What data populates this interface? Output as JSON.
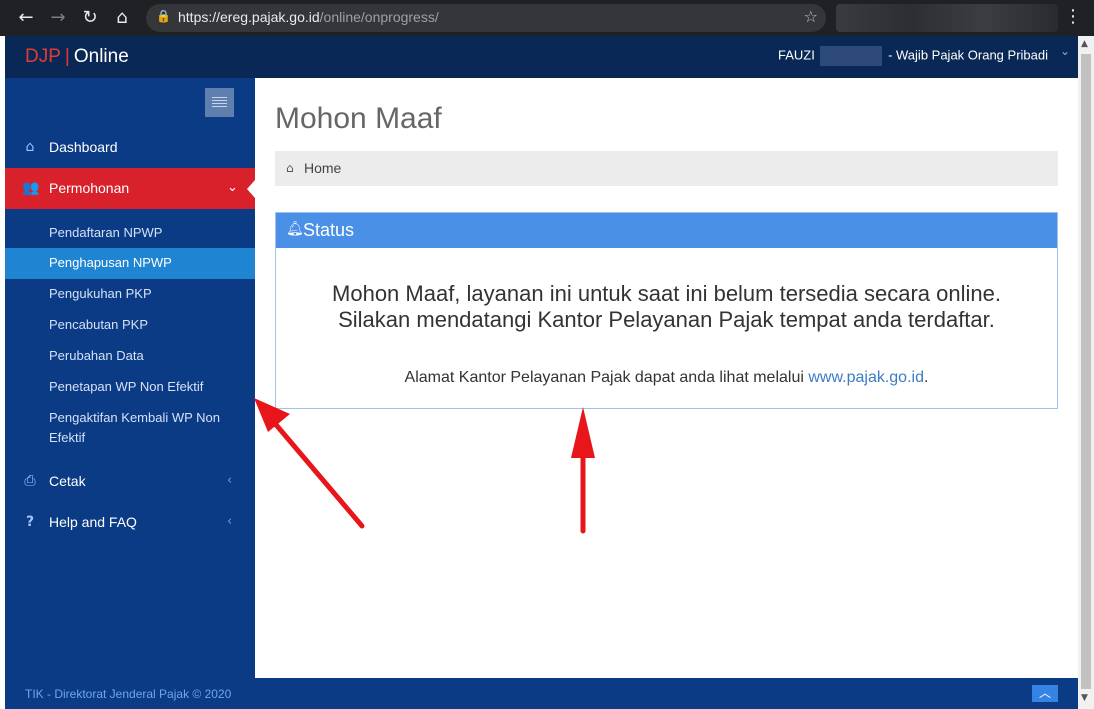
{
  "browser": {
    "url_host": "https://ereg.pajak.go.id",
    "url_path": "/online/onprogress/"
  },
  "header": {
    "brand_djp": "DJP",
    "brand_sep": "|",
    "brand_online": "Online",
    "user_name": "FAUZI",
    "user_role": "- Wajib Pajak Orang Pribadi"
  },
  "sidebar": {
    "items": [
      {
        "label": "Dashboard",
        "icon": "home-icon"
      },
      {
        "label": "Permohonan",
        "icon": "user-group-icon"
      },
      {
        "label": "Cetak",
        "icon": "printer-icon"
      },
      {
        "label": "Help and FAQ",
        "icon": "question-icon"
      }
    ],
    "sub_items": [
      {
        "label": "Pendaftaran NPWP"
      },
      {
        "label": "Penghapusan NPWP"
      },
      {
        "label": "Pengukuhan PKP"
      },
      {
        "label": "Pencabutan PKP"
      },
      {
        "label": "Perubahan Data"
      },
      {
        "label": "Penetapan WP Non Efektif"
      },
      {
        "label": "Pengaktifan Kembali WP Non Efektif"
      }
    ]
  },
  "main": {
    "title": "Mohon Maaf",
    "breadcrumb": "Home",
    "panel_title": "Status",
    "message_line1": "Mohon Maaf, layanan ini untuk saat ini belum tersedia secara online.",
    "message_line2": "Silakan mendatangi Kantor Pelayanan Pajak tempat anda terdaftar.",
    "address_prefix": "Alamat Kantor Pelayanan Pajak dapat anda lihat melalui ",
    "address_link": "www.pajak.go.id",
    "address_suffix": "."
  },
  "footer": {
    "text": "TIK - Direktorat Jenderal Pajak © 2020"
  },
  "colors": {
    "topbar": "#0a2856",
    "sidebar": "#0b3b85",
    "active_red": "#d8212b",
    "active_blue": "#1f84d1",
    "panel_head": "#4a90e6",
    "annotation_arrow": "#e8151b"
  }
}
